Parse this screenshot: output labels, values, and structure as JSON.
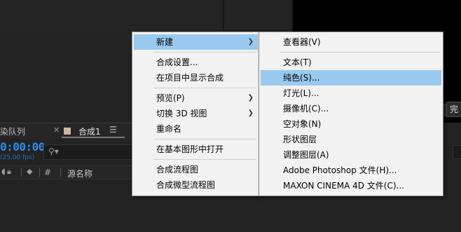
{
  "background": {
    "render_queue_tab": "染队列",
    "comp_tab": "合成1",
    "timecode": "0:00:00",
    "fps": "(25.00 fps)",
    "column_hash": "#",
    "column_source_name": "源名称",
    "right_button": "完"
  },
  "main_menu": {
    "items": [
      {
        "label": "新建",
        "submenu": true
      },
      {
        "label": "合成设置..."
      },
      {
        "label": "在项目中显示合成"
      },
      {
        "label": "预览(P)",
        "submenu": true
      },
      {
        "label": "切换 3D 视图",
        "submenu": true
      },
      {
        "label": "重命名"
      },
      {
        "label": "在基本图形中打开"
      },
      {
        "label": "合成流程图"
      },
      {
        "label": "合成微型流程图"
      }
    ]
  },
  "submenu": {
    "items": [
      {
        "label": "查看器(V)"
      },
      {
        "label": "文本(T)"
      },
      {
        "label": "纯色(S)..."
      },
      {
        "label": "灯光(L)..."
      },
      {
        "label": "摄像机(C)..."
      },
      {
        "label": "空对象(N)"
      },
      {
        "label": "形状图层"
      },
      {
        "label": "调整图层(A)"
      },
      {
        "label": "Adobe Photoshop 文件(H)..."
      },
      {
        "label": "MAXON CINEMA 4D 文件(C)..."
      }
    ]
  },
  "colors": {
    "menu_bg": "#f2f2f2",
    "highlight": "#99c9ef",
    "timecode": "#2d8ceb",
    "app_bg": "#232323"
  }
}
